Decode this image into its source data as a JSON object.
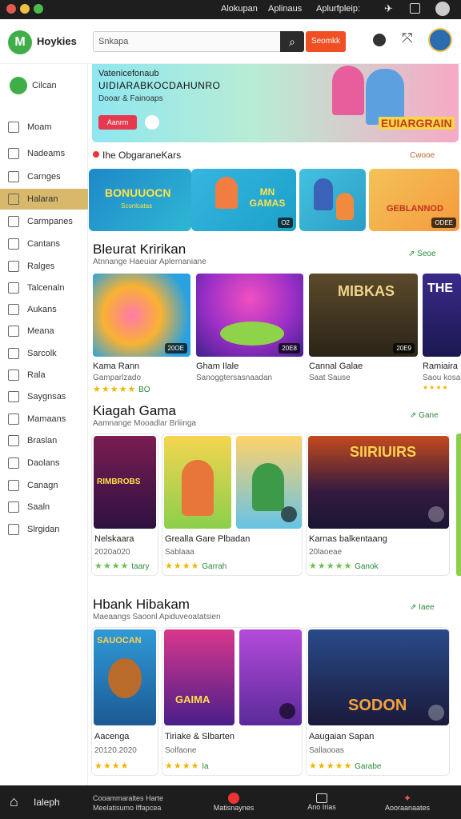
{
  "titlebar": {
    "items": [
      "Alokupan",
      "Aplinaus",
      "Aplurfpleip:"
    ]
  },
  "header": {
    "brand": "Hoykies",
    "search_placeholder": "Snkapa",
    "search_button": "Seomkk"
  },
  "sidebar": {
    "top_item": "Cilcan",
    "items": [
      {
        "label": "Moam",
        "icon": "home-icon"
      },
      {
        "label": "Nadeams",
        "icon": "grid-icon"
      },
      {
        "label": "Carnges",
        "icon": "store-icon"
      },
      {
        "label": "Halaran",
        "icon": "gamepad-icon",
        "active": true
      },
      {
        "label": "Carmpanes",
        "icon": "folder-icon"
      },
      {
        "label": "Cantans",
        "icon": "box-icon"
      },
      {
        "label": "Ralges",
        "icon": "list-icon"
      },
      {
        "label": "Talcenaln",
        "icon": "upload-icon"
      },
      {
        "label": "Aukans",
        "icon": "tag-icon"
      },
      {
        "label": "Meana",
        "icon": "image-icon"
      },
      {
        "label": "Sarcolk",
        "icon": "book-icon"
      },
      {
        "label": "Rala",
        "icon": "chart-icon"
      },
      {
        "label": "Saygnsas",
        "icon": "check-icon"
      },
      {
        "label": "Mamaans",
        "icon": "mail-icon"
      },
      {
        "label": "Braslan",
        "icon": "checkbox-icon"
      },
      {
        "label": "Daolans",
        "icon": "doc-icon"
      },
      {
        "label": "Canagn",
        "icon": "calendar-icon"
      },
      {
        "label": "Saaln",
        "icon": "code-icon"
      },
      {
        "label": "Slrgidan",
        "icon": "table-icon"
      }
    ]
  },
  "hero": {
    "title": "Vatenicefonaub",
    "subtitle": "UIDIARABKOCDAHUNRO",
    "line3": "Dooar & Fainoaps",
    "button": "Aanrm",
    "art_text": "EUIARGRAIN"
  },
  "featured": {
    "title": "Ihe ObgaraneKars",
    "more": "Cwooe",
    "cards": [
      {
        "text": "BONUUOCN",
        "sub": "Sconlcatas"
      },
      {
        "text": "MN GAMAS",
        "badge": "O2"
      },
      {
        "text": "",
        "badge": ""
      },
      {
        "text": "GEBLANNOD",
        "badge": "ODEE"
      }
    ]
  },
  "section1": {
    "title": "Bleurat Kririkan",
    "subtitle": "Atnnange Haeuiar Aplernaniane",
    "more": "Seoe",
    "games": [
      {
        "name": "Kama Rann",
        "meta": "Gamparlzado",
        "stars": "★★★★★",
        "tag": "BO",
        "badge": "20OE"
      },
      {
        "name": "Gham Ilale",
        "meta": "Sanoggtersasnaadan",
        "stars": "",
        "tag": "",
        "badge": "20E8"
      },
      {
        "name": "Cannal Galae",
        "meta": "Saat Sause",
        "stars": "",
        "tag": "",
        "badge": "20E9",
        "art": "MIBKAS"
      },
      {
        "name": "Ramiaira",
        "meta": "Saou kosan",
        "stars": "★★★★",
        "tag": "",
        "badge": "",
        "art": "THE"
      }
    ]
  },
  "section2": {
    "title": "Kiagah Gama",
    "subtitle": "Aamnange Mooadlar Brliinga",
    "more": "Gane",
    "games": [
      {
        "name": "Nelskaara",
        "meta": "2020a020",
        "stars": "★★★★",
        "tag": "taary",
        "art": "RIMBROBS"
      },
      {
        "name": "Grealla Gare  Plbadan",
        "meta": "Sablaaa",
        "stars": "★★★★",
        "tag": "Garrah",
        "art": ""
      },
      {
        "name": "Karnas balkentaang",
        "meta": "20laoeae",
        "stars": "★★★★★",
        "tag": "Ganok",
        "art": "SIIRIUIRS"
      }
    ]
  },
  "section3": {
    "title": "Hbank Hibakam",
    "subtitle": "Maeaangs Saoonl Apiduveoatatsien",
    "more": "Iaee",
    "games": [
      {
        "name": "Aacenga",
        "meta": "20120.2020",
        "stars": "★★★★",
        "tag": "",
        "art": "SAUOCAN"
      },
      {
        "name": "Tiriake & Slbarten",
        "meta": "Solfaone",
        "stars": "★★★★",
        "tag": "Ia",
        "art": "GAIMA"
      },
      {
        "name": "Aaugaian Sapan",
        "meta": "Sallaooas",
        "stars": "★★★★★",
        "tag": "Garabe",
        "art": "SODON"
      }
    ]
  },
  "bottombar": {
    "home": "Ialeph",
    "info_line1": "Cooammaraltes Harte",
    "info_line2": "Meelatisumo Iffapcea",
    "items": [
      "Matisnaynes",
      "Ano Irias",
      "Aooraanaates"
    ]
  },
  "colors": {
    "brand_green": "#3fae49",
    "accent_orange": "#f04e23",
    "sidebar_active": "#d8b86a",
    "link_green": "#2a8a3a"
  }
}
